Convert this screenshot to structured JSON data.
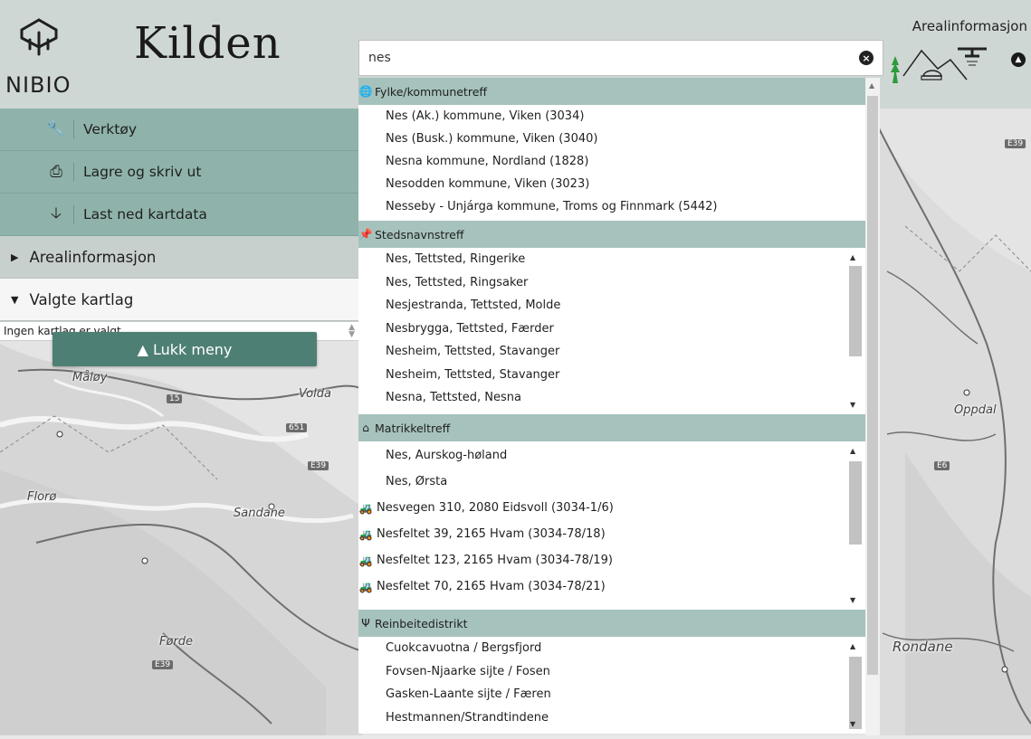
{
  "app": {
    "org_name": "NIBIO",
    "title": "Kilden",
    "theme_label": "Arealinformasjon"
  },
  "map": {
    "place_labels": [
      "Måløy",
      "Volda",
      "Florø",
      "Sandane",
      "Førde",
      "Oppdal",
      "Rondane"
    ],
    "road_labels": [
      "15",
      "651",
      "E39",
      "E39",
      "E6",
      "E39"
    ]
  },
  "menu": {
    "tools": [
      {
        "label": "Verktøy",
        "icon": "wrench-icon"
      },
      {
        "label": "Lagre og skriv ut",
        "icon": "print-icon"
      },
      {
        "label": "Last ned kartdata",
        "icon": "download-icon"
      }
    ],
    "sections": [
      {
        "label": "Arealinformasjon",
        "state": "collapsed"
      },
      {
        "label": "Valgte kartlag",
        "state": "expanded"
      }
    ],
    "layers_select_value": "Ingen kartlag er valgt",
    "close_label": "▲ Lukk meny"
  },
  "search": {
    "value": "nes",
    "clear_icon": "x-circle-icon",
    "groups": [
      {
        "header": "Fylke/kommunetreff",
        "icon": "globe-icon",
        "items": [
          "Nes (Ak.) kommune, Viken (3034)",
          "Nes (Busk.) kommune, Viken (3040)",
          "Nesna kommune, Nordland (1828)",
          "Nesodden kommune, Viken (3023)",
          "Nesseby - Unjárga kommune, Troms og Finnmark (5442)"
        ]
      },
      {
        "header": "Stedsnavnstreff",
        "icon": "pin-icon",
        "items": [
          "Nes, Tettsted, Ringerike",
          "Nes, Tettsted, Ringsaker",
          "Nesjestranda, Tettsted, Molde",
          "Nesbrygga, Tettsted, Færder",
          "Nesheim, Tettsted, Stavanger",
          "Nesheim, Tettsted, Stavanger",
          "Nesna, Tettsted, Nesna"
        ]
      },
      {
        "header": "Matrikkeltreff",
        "icon": "home-icon",
        "items": [
          {
            "text": "Nes, Aurskog-høland",
            "icon": ""
          },
          {
            "text": "Nes, Ørsta",
            "icon": ""
          },
          {
            "text": "Nesvegen 310, 2080 Eidsvoll (3034-1/6)",
            "icon": "tractor-icon"
          },
          {
            "text": "Nesfeltet 39, 2165 Hvam (3034-78/18)",
            "icon": "tractor-icon"
          },
          {
            "text": "Nesfeltet 123, 2165 Hvam (3034-78/19)",
            "icon": "tractor-icon"
          },
          {
            "text": "Nesfeltet 70, 2165 Hvam (3034-78/21)",
            "icon": "tractor-icon"
          }
        ]
      },
      {
        "header": "Reinbeitedistrikt",
        "icon": "antlers-icon",
        "items": [
          "Cuokcavuotna / Bergsfjord",
          "Fovsen-Njaarke sijte / Fosen",
          "Gasken-Laante sijte / Færen",
          "Hestmannen/Strandtindene"
        ]
      }
    ]
  },
  "colors": {
    "header_bg": "#cdd6d2",
    "tool_bg": "#8fb3aa",
    "section_bg": "#c8d0cd",
    "group_header_bg": "#a6c2bd",
    "close_button_bg": "#4e7f74"
  }
}
